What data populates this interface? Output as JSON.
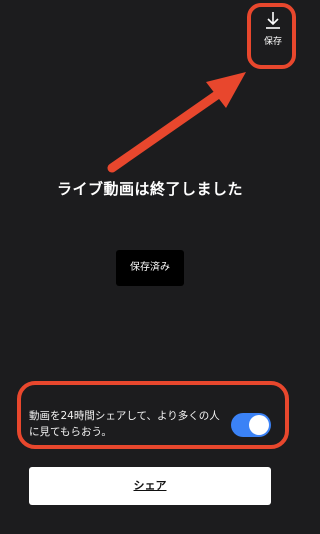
{
  "header": {
    "save_label": "保存",
    "save_icon": "download-icon"
  },
  "main": {
    "ended_title": "ライブ動画は終了しました",
    "saved_button_label": "保存済み"
  },
  "share_option": {
    "text": "動画を24時間シェアして、より多くの人に見てもらおう。",
    "toggle_on": true
  },
  "footer": {
    "share_button_label": "シェア"
  },
  "colors": {
    "background": "#1c1c1e",
    "highlight": "#e8472d",
    "toggle": "#3b82f6"
  }
}
